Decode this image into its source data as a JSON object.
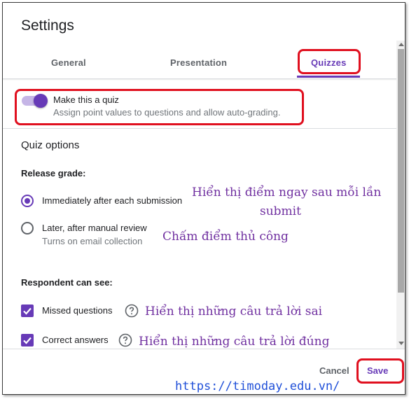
{
  "dialog": {
    "title": "Settings"
  },
  "tabs": [
    {
      "label": "General"
    },
    {
      "label": "Presentation"
    },
    {
      "label": "Quizzes",
      "active": true
    }
  ],
  "quiz_toggle": {
    "label": "Make this a quiz",
    "description": "Assign point values to questions and allow auto-grading.",
    "on": true
  },
  "quiz_options": {
    "title": "Quiz options",
    "release_grade": {
      "label": "Release grade:",
      "options": [
        {
          "label": "Immediately after each submission",
          "selected": true
        },
        {
          "label": "Later, after manual review",
          "sublabel": "Turns on email collection",
          "selected": false
        }
      ]
    },
    "respondent_can_see": {
      "label": "Respondent can see:",
      "options": [
        {
          "label": "Missed questions",
          "checked": true
        },
        {
          "label": "Correct answers",
          "checked": true
        }
      ]
    }
  },
  "annotations": {
    "immediate_line1": "Hiển thị điểm ngay sau mỗi lần",
    "immediate_line2": "submit",
    "manual": "Chấm điểm thủ công",
    "missed": "Hiển thị những câu trả lời sai",
    "correct": "Hiển thị những câu trả lời đúng"
  },
  "footer": {
    "cancel_label": "Cancel",
    "save_label": "Save"
  },
  "watermark": "https://timoday.edu.vn/",
  "colors": {
    "accent": "#673ab7",
    "highlight_box": "#e0101f",
    "annotation_text": "#7030a0",
    "watermark": "#1f4fd8"
  },
  "icons": [
    "help-circle-icon",
    "checkmark-icon"
  ]
}
